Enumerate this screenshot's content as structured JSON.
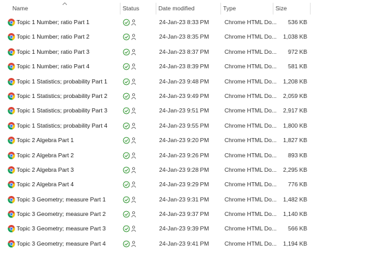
{
  "columns": {
    "name": "Name",
    "status": "Status",
    "date": "Date modified",
    "type": "Type",
    "size": "Size"
  },
  "colors": {
    "status_ok": "#3a9a3a",
    "chrome_red": "#db4437",
    "chrome_yellow": "#f4c20d",
    "chrome_green": "#0f9d58",
    "chrome_blue": "#4285f4"
  },
  "icons": {
    "file": "chrome-html-icon",
    "status": "available-check-icon",
    "sync": "person-sync-icon"
  },
  "files": [
    {
      "name": "Topic 1 Number; ratio Part 1",
      "date": "24-Jan-23 8:33 PM",
      "type": "Chrome HTML Do...",
      "size": "536 KB"
    },
    {
      "name": "Topic 1 Number; ratio Part 2",
      "date": "24-Jan-23 8:35 PM",
      "type": "Chrome HTML Do...",
      "size": "1,038 KB"
    },
    {
      "name": "Topic 1 Number; ratio Part 3",
      "date": "24-Jan-23 8:37 PM",
      "type": "Chrome HTML Do...",
      "size": "972 KB"
    },
    {
      "name": "Topic 1 Number; ratio Part 4",
      "date": "24-Jan-23 8:39 PM",
      "type": "Chrome HTML Do...",
      "size": "581 KB"
    },
    {
      "name": "Topic 1 Statistics; probability Part 1",
      "date": "24-Jan-23 9:48 PM",
      "type": "Chrome HTML Do...",
      "size": "1,208 KB"
    },
    {
      "name": "Topic 1 Statistics; probability Part 2",
      "date": "24-Jan-23 9:49 PM",
      "type": "Chrome HTML Do...",
      "size": "2,059 KB"
    },
    {
      "name": "Topic 1 Statistics; probability Part 3",
      "date": "24-Jan-23 9:51 PM",
      "type": "Chrome HTML Do...",
      "size": "2,917 KB"
    },
    {
      "name": "Topic 1 Statistics; probability Part 4",
      "date": "24-Jan-23 9:55 PM",
      "type": "Chrome HTML Do...",
      "size": "1,800 KB"
    },
    {
      "name": "Topic 2 Algebra Part 1",
      "date": "24-Jan-23 9:20 PM",
      "type": "Chrome HTML Do...",
      "size": "1,827 KB"
    },
    {
      "name": "Topic 2 Algebra Part 2",
      "date": "24-Jan-23 9:26 PM",
      "type": "Chrome HTML Do...",
      "size": "893 KB"
    },
    {
      "name": "Topic 2 Algebra Part 3",
      "date": "24-Jan-23 9:28 PM",
      "type": "Chrome HTML Do...",
      "size": "2,295 KB"
    },
    {
      "name": "Topic 2 Algebra Part 4",
      "date": "24-Jan-23 9:29 PM",
      "type": "Chrome HTML Do...",
      "size": "776 KB"
    },
    {
      "name": "Topic 3 Geometry; measure Part 1",
      "date": "24-Jan-23 9:31 PM",
      "type": "Chrome HTML Do...",
      "size": "1,482 KB"
    },
    {
      "name": "Topic 3 Geometry; measure Part 2",
      "date": "24-Jan-23 9:37 PM",
      "type": "Chrome HTML Do...",
      "size": "1,140 KB"
    },
    {
      "name": "Topic 3 Geometry; measure Part 3",
      "date": "24-Jan-23 9:39 PM",
      "type": "Chrome HTML Do...",
      "size": "566 KB"
    },
    {
      "name": "Topic 3 Geometry; measure Part 4",
      "date": "24-Jan-23 9:41 PM",
      "type": "Chrome HTML Do...",
      "size": "1,194 KB"
    }
  ]
}
